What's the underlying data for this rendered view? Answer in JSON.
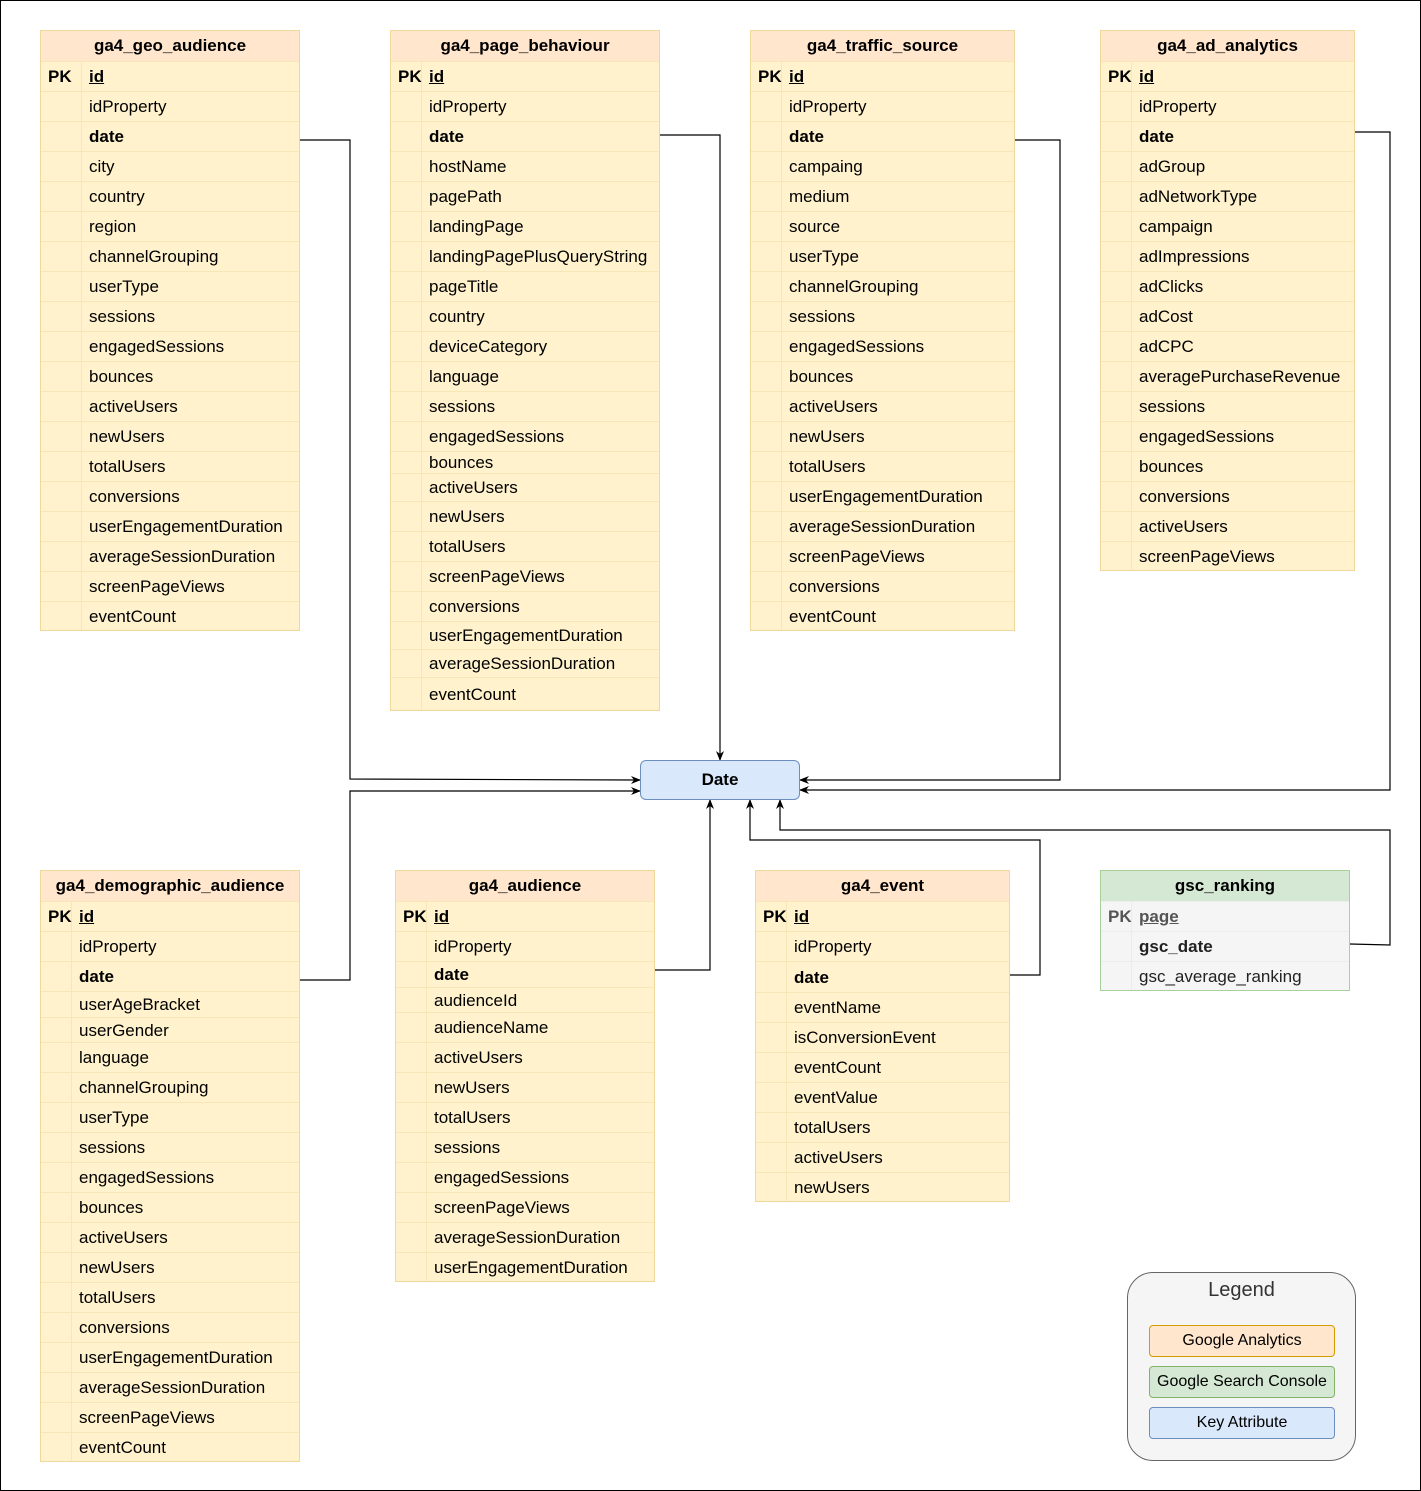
{
  "diagram": {
    "type": "entity-relationship",
    "tables": [
      {
        "id": "ga4_geo_audience",
        "name": "ga4_geo_audience",
        "source": "Google Analytics",
        "pk_label": "PK",
        "fields": [
          {
            "name": "id",
            "style": "key"
          },
          {
            "name": "idProperty",
            "style": "normal"
          },
          {
            "name": "date",
            "style": "bold"
          },
          {
            "name": "city",
            "style": "normal"
          },
          {
            "name": "country",
            "style": "normal"
          },
          {
            "name": "region",
            "style": "normal"
          },
          {
            "name": "channelGrouping",
            "style": "normal"
          },
          {
            "name": "userType",
            "style": "normal"
          },
          {
            "name": "sessions",
            "style": "normal"
          },
          {
            "name": "engagedSessions",
            "style": "normal"
          },
          {
            "name": "bounces",
            "style": "normal"
          },
          {
            "name": "activeUsers",
            "style": "normal"
          },
          {
            "name": "newUsers",
            "style": "normal"
          },
          {
            "name": "totalUsers",
            "style": "normal"
          },
          {
            "name": "conversions",
            "style": "normal"
          },
          {
            "name": "userEngagementDuration",
            "style": "normal"
          },
          {
            "name": "averageSessionDuration",
            "style": "normal"
          },
          {
            "name": "screenPageViews",
            "style": "normal"
          },
          {
            "name": "eventCount",
            "style": "normal"
          }
        ]
      },
      {
        "id": "ga4_page_behaviour",
        "name": "ga4_page_behaviour",
        "source": "Google Analytics",
        "pk_label": "PK",
        "fields": [
          {
            "name": "id",
            "style": "key"
          },
          {
            "name": "idProperty",
            "style": "normal"
          },
          {
            "name": "date",
            "style": "bold"
          },
          {
            "name": "hostName",
            "style": "normal"
          },
          {
            "name": "pagePath",
            "style": "normal"
          },
          {
            "name": "landingPage",
            "style": "normal"
          },
          {
            "name": "landingPagePlusQueryString",
            "style": "normal"
          },
          {
            "name": "pageTitle",
            "style": "normal"
          },
          {
            "name": "country",
            "style": "normal"
          },
          {
            "name": "deviceCategory",
            "style": "normal"
          },
          {
            "name": "language",
            "style": "normal"
          },
          {
            "name": "sessions",
            "style": "normal"
          },
          {
            "name": "engagedSessions",
            "style": "normal"
          },
          {
            "name": "bounces",
            "style": "normal"
          },
          {
            "name": "activeUsers",
            "style": "normal"
          },
          {
            "name": "newUsers",
            "style": "normal"
          },
          {
            "name": "totalUsers",
            "style": "normal"
          },
          {
            "name": "screenPageViews",
            "style": "normal"
          },
          {
            "name": "conversions",
            "style": "normal"
          },
          {
            "name": "userEngagementDuration",
            "style": "normal"
          },
          {
            "name": "averageSessionDuration",
            "style": "normal"
          },
          {
            "name": "eventCount",
            "style": "normal"
          }
        ]
      },
      {
        "id": "ga4_traffic_source",
        "name": "ga4_traffic_source",
        "source": "Google Analytics",
        "pk_label": "PK",
        "fields": [
          {
            "name": "id",
            "style": "key"
          },
          {
            "name": "idProperty",
            "style": "normal"
          },
          {
            "name": "date",
            "style": "bold"
          },
          {
            "name": "campaing",
            "style": "normal"
          },
          {
            "name": "medium",
            "style": "normal"
          },
          {
            "name": "source",
            "style": "normal"
          },
          {
            "name": "userType",
            "style": "normal"
          },
          {
            "name": "channelGrouping",
            "style": "normal"
          },
          {
            "name": "sessions",
            "style": "normal"
          },
          {
            "name": "engagedSessions",
            "style": "normal"
          },
          {
            "name": "bounces",
            "style": "normal"
          },
          {
            "name": "activeUsers",
            "style": "normal"
          },
          {
            "name": "newUsers",
            "style": "normal"
          },
          {
            "name": "totalUsers",
            "style": "normal"
          },
          {
            "name": "userEngagementDuration",
            "style": "normal"
          },
          {
            "name": "averageSessionDuration",
            "style": "normal"
          },
          {
            "name": "screenPageViews",
            "style": "normal"
          },
          {
            "name": "conversions",
            "style": "normal"
          },
          {
            "name": "eventCount",
            "style": "normal"
          }
        ]
      },
      {
        "id": "ga4_ad_analytics",
        "name": "ga4_ad_analytics",
        "source": "Google Analytics",
        "pk_label": "PK",
        "fields": [
          {
            "name": "id",
            "style": "key"
          },
          {
            "name": "idProperty",
            "style": "normal"
          },
          {
            "name": "date",
            "style": "bold"
          },
          {
            "name": "adGroup",
            "style": "normal"
          },
          {
            "name": "adNetworkType",
            "style": "normal"
          },
          {
            "name": "campaign",
            "style": "normal"
          },
          {
            "name": "adImpressions",
            "style": "normal"
          },
          {
            "name": "adClicks",
            "style": "normal"
          },
          {
            "name": "adCost",
            "style": "normal"
          },
          {
            "name": "adCPC",
            "style": "normal"
          },
          {
            "name": "averagePurchaseRevenue",
            "style": "normal"
          },
          {
            "name": "sessions",
            "style": "normal"
          },
          {
            "name": "engagedSessions",
            "style": "normal"
          },
          {
            "name": "bounces",
            "style": "normal"
          },
          {
            "name": "conversions",
            "style": "normal"
          },
          {
            "name": "activeUsers",
            "style": "normal"
          },
          {
            "name": "screenPageViews",
            "style": "normal"
          }
        ]
      },
      {
        "id": "ga4_demographic_audience",
        "name": "ga4_demographic_audience",
        "source": "Google Analytics",
        "pk_label": "PK",
        "fields": [
          {
            "name": "id",
            "style": "key"
          },
          {
            "name": "idProperty",
            "style": "normal"
          },
          {
            "name": "date",
            "style": "bold"
          },
          {
            "name": "userAgeBracket",
            "style": "normal"
          },
          {
            "name": "userGender",
            "style": "normal"
          },
          {
            "name": "language",
            "style": "normal"
          },
          {
            "name": "channelGrouping",
            "style": "normal"
          },
          {
            "name": "userType",
            "style": "normal"
          },
          {
            "name": "sessions",
            "style": "normal"
          },
          {
            "name": "engagedSessions",
            "style": "normal"
          },
          {
            "name": "bounces",
            "style": "normal"
          },
          {
            "name": "activeUsers",
            "style": "normal"
          },
          {
            "name": "newUsers",
            "style": "normal"
          },
          {
            "name": "totalUsers",
            "style": "normal"
          },
          {
            "name": "conversions",
            "style": "normal"
          },
          {
            "name": "userEngagementDuration",
            "style": "normal"
          },
          {
            "name": "averageSessionDuration",
            "style": "normal"
          },
          {
            "name": "screenPageViews",
            "style": "normal"
          },
          {
            "name": "eventCount",
            "style": "normal"
          }
        ]
      },
      {
        "id": "ga4_audience",
        "name": "ga4_audience",
        "source": "Google Analytics",
        "pk_label": "PK",
        "fields": [
          {
            "name": "id",
            "style": "key"
          },
          {
            "name": "idProperty",
            "style": "normal"
          },
          {
            "name": "date",
            "style": "bold"
          },
          {
            "name": "audienceId",
            "style": "normal"
          },
          {
            "name": "audienceName",
            "style": "normal"
          },
          {
            "name": "activeUsers",
            "style": "normal"
          },
          {
            "name": "newUsers",
            "style": "normal"
          },
          {
            "name": "totalUsers",
            "style": "normal"
          },
          {
            "name": "sessions",
            "style": "normal"
          },
          {
            "name": "engagedSessions",
            "style": "normal"
          },
          {
            "name": "screenPageViews",
            "style": "normal"
          },
          {
            "name": "averageSessionDuration",
            "style": "normal"
          },
          {
            "name": "userEngagementDuration",
            "style": "normal"
          }
        ]
      },
      {
        "id": "ga4_event",
        "name": "ga4_event",
        "source": "Google Analytics",
        "pk_label": "PK",
        "fields": [
          {
            "name": "id",
            "style": "key"
          },
          {
            "name": "idProperty",
            "style": "normal"
          },
          {
            "name": "date",
            "style": "bold"
          },
          {
            "name": "eventName",
            "style": "normal"
          },
          {
            "name": "isConversionEvent",
            "style": "normal"
          },
          {
            "name": "eventCount",
            "style": "normal"
          },
          {
            "name": "eventValue",
            "style": "normal"
          },
          {
            "name": "totalUsers",
            "style": "normal"
          },
          {
            "name": "activeUsers",
            "style": "normal"
          },
          {
            "name": "newUsers",
            "style": "normal"
          }
        ]
      },
      {
        "id": "gsc_ranking",
        "name": "gsc_ranking",
        "source": "Google Search Console",
        "pk_label": "PK",
        "fields": [
          {
            "name": "page",
            "style": "key"
          },
          {
            "name": "gsc_date",
            "style": "bold"
          },
          {
            "name": "gsc_average_ranking",
            "style": "normal"
          }
        ]
      }
    ],
    "key_entity": {
      "name": "Date"
    },
    "relationships": [
      {
        "from": "ga4_geo_audience.date",
        "to": "Date"
      },
      {
        "from": "ga4_page_behaviour.date",
        "to": "Date"
      },
      {
        "from": "ga4_traffic_source.date",
        "to": "Date"
      },
      {
        "from": "ga4_ad_analytics.date",
        "to": "Date"
      },
      {
        "from": "ga4_demographic_audience.date",
        "to": "Date"
      },
      {
        "from": "ga4_audience.date",
        "to": "Date"
      },
      {
        "from": "ga4_event.date",
        "to": "Date"
      },
      {
        "from": "gsc_ranking.gsc_date",
        "to": "Date"
      }
    ],
    "legend": {
      "title": "Legend",
      "items": [
        {
          "label": "Google Analytics",
          "fill": "#ffe6cc",
          "stroke": "#d79b00"
        },
        {
          "label": "Google Search Console",
          "fill": "#d5e8d4",
          "stroke": "#82b366"
        },
        {
          "label": "Key Attribute",
          "fill": "#dae8fc",
          "stroke": "#6c8ebf"
        }
      ]
    },
    "colors": {
      "ga_header": "#ffe6cc",
      "ga_body": "#fff2cc",
      "gsc_header": "#d5e8d4",
      "gsc_body": "#f5f5f5",
      "key_fill": "#dae8fc"
    }
  }
}
